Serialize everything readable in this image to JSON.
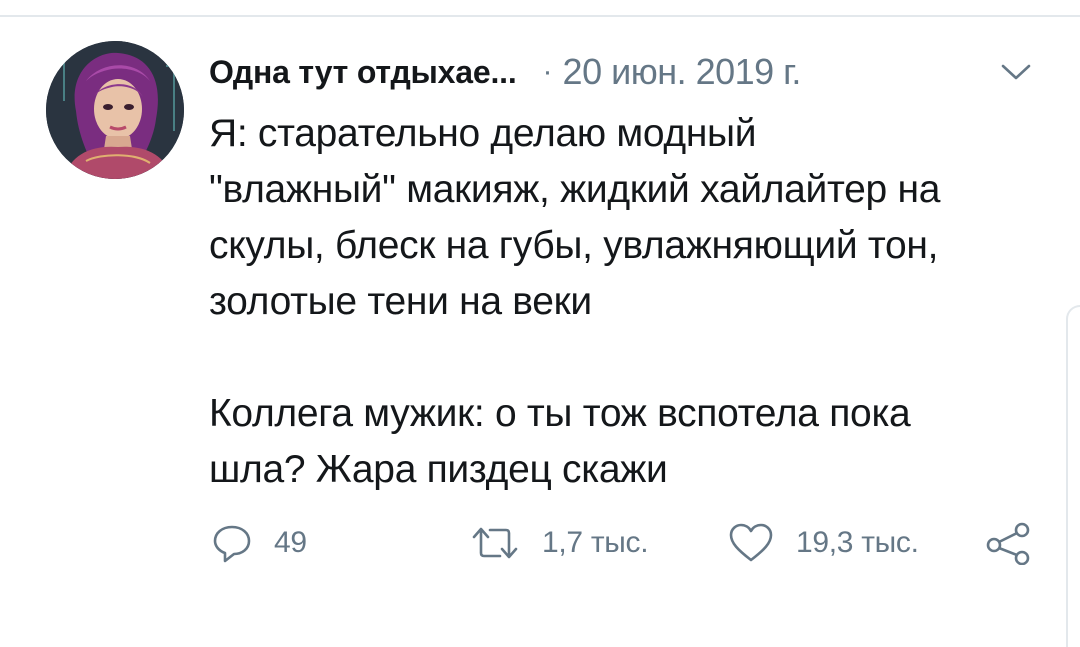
{
  "tweet": {
    "author_name": "Одна тут отдыхае...",
    "separator": "·",
    "date": "20 июн. 2019 г.",
    "text_paragraph_1_lines": [
      "Я: старательно делаю модный",
      "\"влажный\" макияж, жидкий хайлайтер на",
      "скулы, блеск на губы, увлажняющий тон,",
      "золотые тени на веки"
    ],
    "text_paragraph_2_lines": [
      "Коллега мужик: о ты тож вспотела пока",
      "шла? Жара пиздец скажи"
    ]
  },
  "actions": {
    "reply_count": "49",
    "retweet_count": "1,7 тыс.",
    "like_count": "19,3 тыс."
  },
  "colors": {
    "text": "#14171a",
    "secondary": "#657786",
    "divider": "#e3e8ec"
  },
  "icons": {
    "reply": "speech-bubble-icon",
    "retweet": "retweet-arrows-icon",
    "like": "heart-icon",
    "share": "share-nodes-icon",
    "menu": "chevron-down-icon"
  }
}
